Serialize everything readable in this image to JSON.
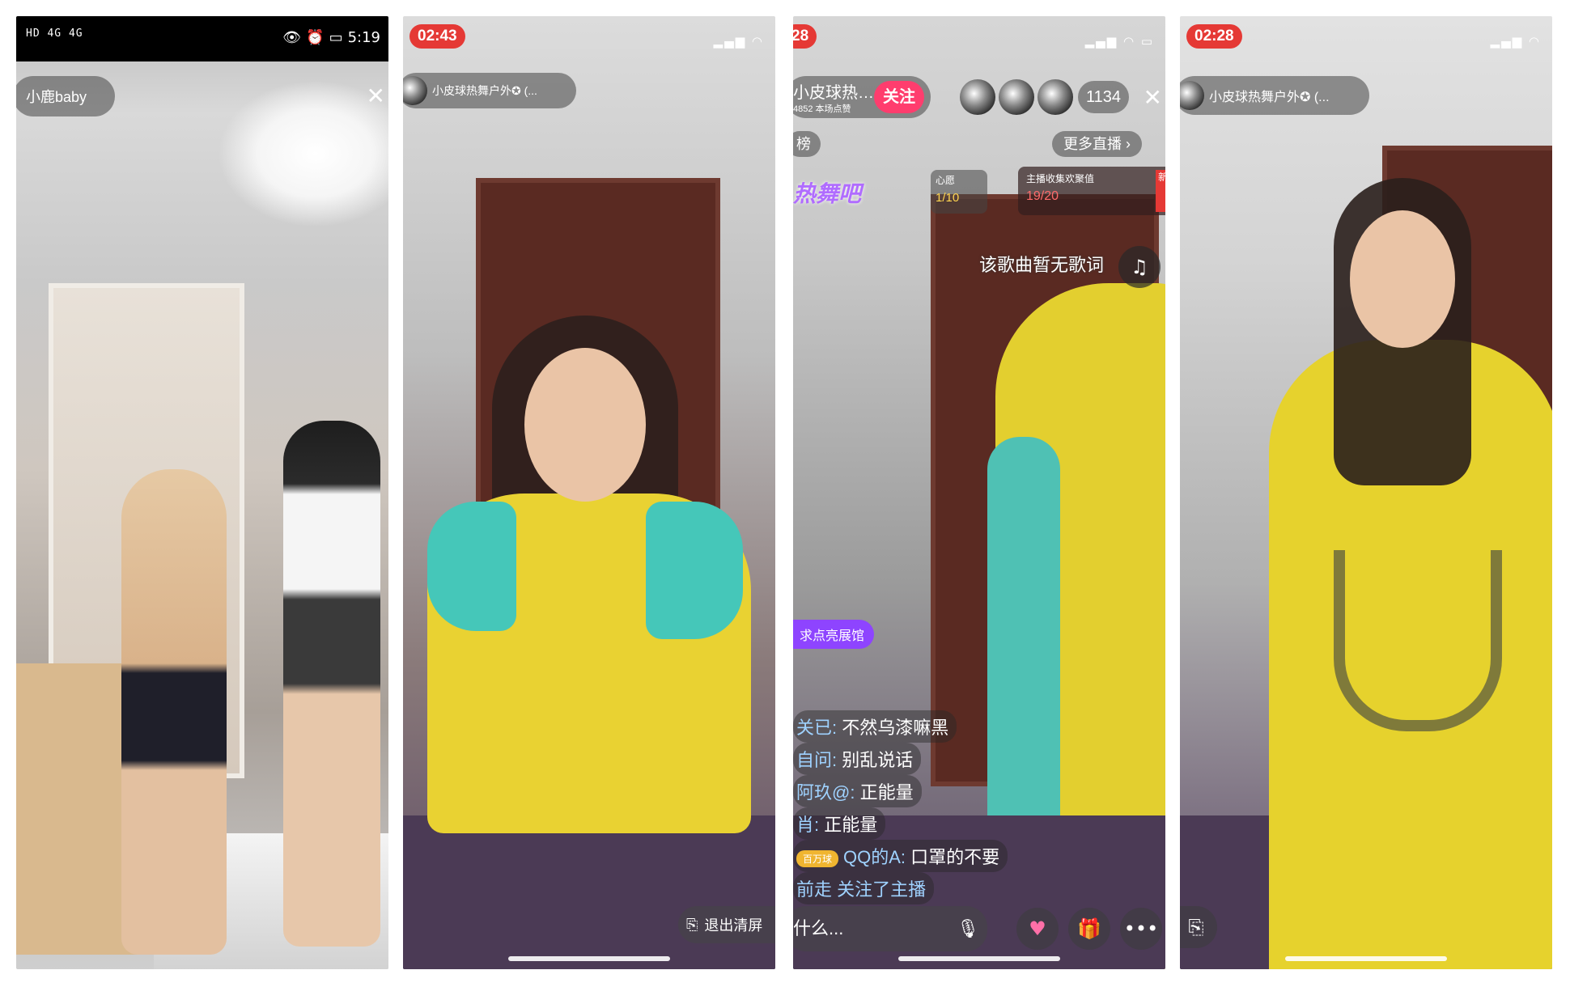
{
  "panels": [
    {
      "status_left": "HD 4G 4G",
      "status_time": "5:19",
      "status_icons": [
        "eye-icon",
        "alarm-icon",
        "battery-icon"
      ],
      "streamer_name": "小鹿baby",
      "close_icon": "✕"
    },
    {
      "time": "02:43",
      "streamer_name": "小皮球热舞户外✪ (...",
      "exit_clear_label": "退出清屏"
    },
    {
      "time": "28",
      "streamer_name": "小皮球热…",
      "likes_label": "4852 本场点赞",
      "follow_label": "关注",
      "viewer_count": "1134",
      "rank_label": "榜",
      "more_live_label": "更多直播",
      "wish_label": "心愿",
      "wish_progress": "1/10",
      "collect_label": "主播收集欢聚值",
      "collect_progress": "19/20",
      "new_tag": "新",
      "dance_badge": "热舞吧",
      "no_lyrics": "该歌曲暂无歌词",
      "showcase_label": "求点亮展馆",
      "chat": [
        {
          "user": "关已:",
          "msg": "不然乌漆嘛黑"
        },
        {
          "user": "自问:",
          "msg": "别乱说话"
        },
        {
          "user": "阿玖@:",
          "msg": "正能量"
        },
        {
          "user": "肖:",
          "msg": "正能量"
        },
        {
          "badge": "百万球",
          "user": "QQ的A:",
          "msg": "口罩的不要"
        },
        {
          "user": "前走 关注了主播",
          "msg": ""
        }
      ],
      "input_placeholder": "什么..."
    },
    {
      "time": "02:28",
      "streamer_name": "小皮球热舞户外✪ (..."
    }
  ]
}
